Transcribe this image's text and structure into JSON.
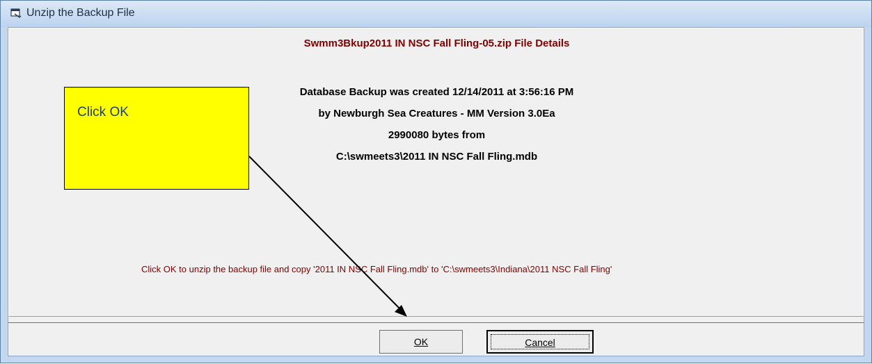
{
  "window": {
    "title": "Unzip the Backup File"
  },
  "file_details": {
    "heading": "Swmm3Bkup2011 IN NSC Fall Fling-05.zip  File Details",
    "line1": "Database Backup was created 12/14/2011 at 3:56:16 PM",
    "line2": "by Newburgh Sea Creatures - MM Version 3.0Ea",
    "line3": "2990080 bytes from",
    "line4": "C:\\swmeets3\\2011 IN NSC Fall Fling.mdb"
  },
  "message": "Click OK to unzip the backup file and copy '2011 IN NSC Fall Fling.mdb'  to  'C:\\swmeets3\\Indiana\\2011 NSC Fall Fling'",
  "callout": {
    "text": "Click OK"
  },
  "buttons": {
    "ok_label": "OK",
    "cancel_label": "Cancel"
  },
  "colors": {
    "heading": "#800000",
    "callout_bg": "#ffff00",
    "callout_text": "#1f3f70"
  }
}
